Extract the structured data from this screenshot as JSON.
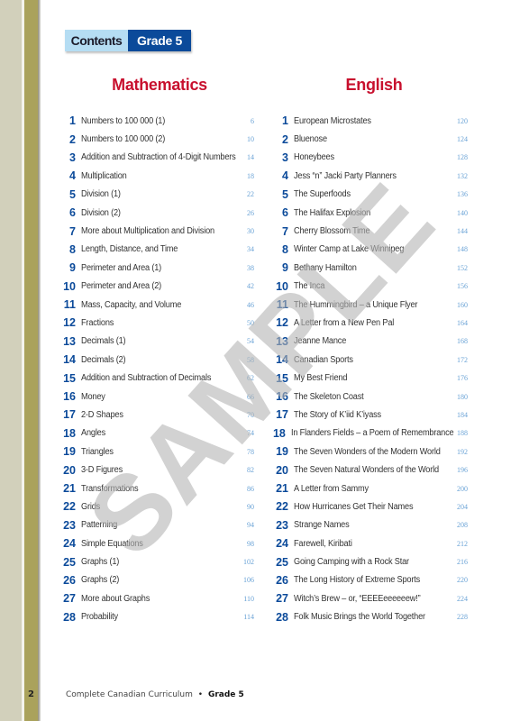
{
  "header": {
    "badge_label": "Contents",
    "badge_grade": "Grade 5"
  },
  "colors": {
    "section_title": "#c8102e",
    "item_number": "#0b4a9a",
    "page_ref": "#6aa3d6",
    "badge_light": "#b5ddf3",
    "badge_dark": "#0b4a9a"
  },
  "watermark": "SAMPLE",
  "mathematics": {
    "title": "Mathematics",
    "items": [
      {
        "num": "1",
        "title": "Numbers to 100 000 (1)",
        "page": "6"
      },
      {
        "num": "2",
        "title": "Numbers to 100 000 (2)",
        "page": "10"
      },
      {
        "num": "3",
        "title": "Addition and Subtraction of 4-Digit Numbers",
        "page": "14"
      },
      {
        "num": "4",
        "title": "Multiplication",
        "page": "18"
      },
      {
        "num": "5",
        "title": "Division (1)",
        "page": "22"
      },
      {
        "num": "6",
        "title": "Division (2)",
        "page": "26"
      },
      {
        "num": "7",
        "title": "More about Multiplication and Division",
        "page": "30"
      },
      {
        "num": "8",
        "title": "Length, Distance, and Time",
        "page": "34"
      },
      {
        "num": "9",
        "title": "Perimeter and Area (1)",
        "page": "38"
      },
      {
        "num": "10",
        "title": "Perimeter and Area (2)",
        "page": "42"
      },
      {
        "num": "11",
        "title": "Mass, Capacity, and Volume",
        "page": "46"
      },
      {
        "num": "12",
        "title": "Fractions",
        "page": "50"
      },
      {
        "num": "13",
        "title": "Decimals (1)",
        "page": "54"
      },
      {
        "num": "14",
        "title": "Decimals (2)",
        "page": "58"
      },
      {
        "num": "15",
        "title": "Addition and Subtraction of Decimals",
        "page": "62"
      },
      {
        "num": "16",
        "title": "Money",
        "page": "66"
      },
      {
        "num": "17",
        "title": "2-D Shapes",
        "page": "70"
      },
      {
        "num": "18",
        "title": "Angles",
        "page": "74"
      },
      {
        "num": "19",
        "title": "Triangles",
        "page": "78"
      },
      {
        "num": "20",
        "title": "3-D Figures",
        "page": "82"
      },
      {
        "num": "21",
        "title": "Transformations",
        "page": "86"
      },
      {
        "num": "22",
        "title": "Grids",
        "page": "90"
      },
      {
        "num": "23",
        "title": "Patterning",
        "page": "94"
      },
      {
        "num": "24",
        "title": "Simple Equations",
        "page": "98"
      },
      {
        "num": "25",
        "title": "Graphs (1)",
        "page": "102"
      },
      {
        "num": "26",
        "title": "Graphs (2)",
        "page": "106"
      },
      {
        "num": "27",
        "title": "More about Graphs",
        "page": "110"
      },
      {
        "num": "28",
        "title": "Probability",
        "page": "114"
      }
    ]
  },
  "english": {
    "title": "English",
    "items": [
      {
        "num": "1",
        "title": "European Microstates",
        "page": "120"
      },
      {
        "num": "2",
        "title": "Bluenose",
        "page": "124"
      },
      {
        "num": "3",
        "title": "Honeybees",
        "page": "128"
      },
      {
        "num": "4",
        "title": "Jess “n” Jacki Party Planners",
        "page": "132"
      },
      {
        "num": "5",
        "title": "The Superfoods",
        "page": "136"
      },
      {
        "num": "6",
        "title": "The Halifax Explosion",
        "page": "140"
      },
      {
        "num": "7",
        "title": "Cherry Blossom Time",
        "page": "144"
      },
      {
        "num": "8",
        "title": "Winter Camp at Lake Winnipeg",
        "page": "148"
      },
      {
        "num": "9",
        "title": "Bethany Hamilton",
        "page": "152"
      },
      {
        "num": "10",
        "title": "The Inca",
        "page": "156"
      },
      {
        "num": "11",
        "title": "The Hummingbird – a Unique Flyer",
        "page": "160"
      },
      {
        "num": "12",
        "title": "A Letter from a New Pen Pal",
        "page": "164"
      },
      {
        "num": "13",
        "title": "Jeanne Mance",
        "page": "168"
      },
      {
        "num": "14",
        "title": "Canadian Sports",
        "page": "172"
      },
      {
        "num": "15",
        "title": "My Best Friend",
        "page": "176"
      },
      {
        "num": "16",
        "title": "The Skeleton Coast",
        "page": "180"
      },
      {
        "num": "17",
        "title": "The Story of K’iid K’iyass",
        "page": "184"
      },
      {
        "num": "18",
        "title": "In Flanders Fields – a Poem of Remembrance",
        "page": "188"
      },
      {
        "num": "19",
        "title": "The Seven Wonders of the Modern World",
        "page": "192"
      },
      {
        "num": "20",
        "title": "The Seven Natural Wonders of the World",
        "page": "196"
      },
      {
        "num": "21",
        "title": "A Letter from Sammy",
        "page": "200"
      },
      {
        "num": "22",
        "title": "How Hurricanes Get Their Names",
        "page": "204"
      },
      {
        "num": "23",
        "title": "Strange Names",
        "page": "208"
      },
      {
        "num": "24",
        "title": "Farewell, Kiribati",
        "page": "212"
      },
      {
        "num": "25",
        "title": "Going Camping with a Rock Star",
        "page": "216"
      },
      {
        "num": "26",
        "title": "The Long History of Extreme Sports",
        "page": "220"
      },
      {
        "num": "27",
        "title": "Witch’s Brew – or, “EEEEeeeeeew!”",
        "page": "224"
      },
      {
        "num": "28",
        "title": "Folk Music Brings the World Together",
        "page": "228"
      }
    ]
  },
  "footer": {
    "page_number": "2",
    "book_title": "Complete Canadian Curriculum",
    "bullet": "•",
    "grade": "Grade 5"
  }
}
